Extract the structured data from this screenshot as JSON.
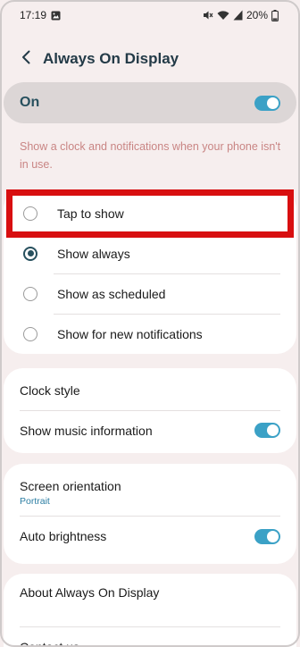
{
  "status_bar": {
    "time": "17:19",
    "battery": "20%",
    "icons": [
      "gallery-notification-icon",
      "mute-icon",
      "wifi-icon",
      "signal-icon",
      "battery-icon"
    ]
  },
  "header": {
    "title": "Always On Display",
    "back_icon": "back-chevron-icon"
  },
  "master": {
    "label": "On",
    "enabled": true
  },
  "description": "Show a clock and notifications when your phone isn't in use.",
  "display_options": [
    {
      "label": "Tap to show",
      "selected": false
    },
    {
      "label": "Show always",
      "selected": true
    },
    {
      "label": "Show as scheduled",
      "selected": false
    },
    {
      "label": "Show for new notifications",
      "selected": false
    }
  ],
  "section1": {
    "clock_style": "Clock style",
    "music_info": "Show music information",
    "music_info_enabled": true
  },
  "section2": {
    "orientation": "Screen orientation",
    "orientation_value": "Portrait",
    "auto_brightness": "Auto brightness",
    "auto_brightness_enabled": true
  },
  "section3": {
    "about": "About Always On Display",
    "contact_us": "Contact us"
  },
  "colors": {
    "accent": "#3ba1c6",
    "highlight": "#d80f10",
    "description_text": "#c98584",
    "background": "#f6eeee"
  }
}
